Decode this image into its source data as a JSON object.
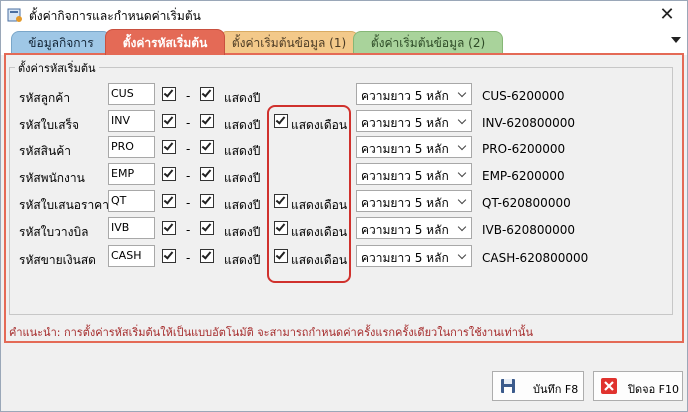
{
  "window": {
    "title": "ตั้งค่ากิจการและกำหนดค่าเริ่มต้น",
    "close_label": "✕"
  },
  "tabs": [
    {
      "label": "ข้อมูลกิจการ"
    },
    {
      "label": "ตั้งค่ารหัสเริ่มต้น",
      "active": true
    },
    {
      "label": "ตั้งค่าเริ่มต้นข้อมูล (1)"
    },
    {
      "label": "ตั้งค่าเริ่มต้นข้อมูล (2)"
    }
  ],
  "group_title": "ตั้งค่ารหัสเริ่มต้น",
  "dash": "-",
  "show_year_label": "แสดงปี",
  "show_month_label": "แสดงเดือน",
  "rows": [
    {
      "label": "รหัสลูกค้า",
      "prefix": "CUS",
      "prefix_checked": true,
      "year_checked": true,
      "show_month": false,
      "length": "ความยาว 5 หลัก",
      "preview": "CUS-6200000"
    },
    {
      "label": "รหัสใบเสร็จ",
      "prefix": "INV",
      "prefix_checked": true,
      "year_checked": true,
      "show_month": true,
      "length": "ความยาว 5 หลัก",
      "preview": "INV-620800000"
    },
    {
      "label": "รหัสสินค้า",
      "prefix": "PRO",
      "prefix_checked": true,
      "year_checked": true,
      "show_month": false,
      "length": "ความยาว 5 หลัก",
      "preview": "PRO-6200000"
    },
    {
      "label": "รหัสพนักงาน",
      "prefix": "EMP",
      "prefix_checked": true,
      "year_checked": true,
      "show_month": false,
      "length": "ความยาว 5 หลัก",
      "preview": "EMP-6200000"
    },
    {
      "label": "รหัสใบเสนอราคา",
      "prefix": "QT",
      "prefix_checked": true,
      "year_checked": true,
      "show_month": true,
      "length": "ความยาว 5 หลัก",
      "preview": "QT-620800000"
    },
    {
      "label": "รหัสใบวางบิล",
      "prefix": "IVB",
      "prefix_checked": true,
      "year_checked": true,
      "show_month": true,
      "length": "ความยาว 5 หลัก",
      "preview": "IVB-620800000"
    },
    {
      "label": "รหัสขายเงินสด",
      "prefix": "CASH",
      "prefix_checked": true,
      "year_checked": true,
      "show_month": true,
      "length": "ความยาว 5 หลัก",
      "preview": "CASH-620800000"
    }
  ],
  "hint": "คำแนะนำ: การตั้งค่ารหัสเริ่มต้นให้เป็นแบบอัตโนมัติ จะสามารถกำหนดค่าครั้งแรกครั้งเดียวในการใช้งานเท่านั้น",
  "buttons": {
    "save": "บันทึก F8",
    "close": "ปิดจอ F10"
  },
  "colors": {
    "active_tab": "#e46a56",
    "highlight_box": "#d0312d",
    "hint_text": "#a52a2a"
  }
}
